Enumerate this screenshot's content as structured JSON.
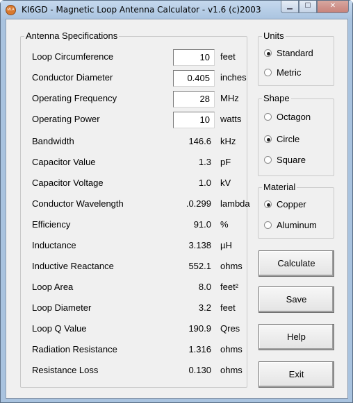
{
  "window": {
    "title": "KI6GD - Magnetic Loop Antenna Calculator - v1.6  (c)2003",
    "icon_text": "MLA",
    "min_glyph": "▁",
    "max_glyph": "☐",
    "close_glyph": "✕"
  },
  "specs": {
    "group_label": "Antenna Specifications",
    "inputs": [
      {
        "label": "Loop Circumference",
        "value": "10",
        "unit": "feet"
      },
      {
        "label": "Conductor Diameter",
        "value": "0.405",
        "unit": "inches"
      },
      {
        "label": "Operating Frequency",
        "value": "28",
        "unit": "MHz"
      },
      {
        "label": "Operating Power",
        "value": "10",
        "unit": "watts"
      }
    ],
    "outputs": [
      {
        "label": "Bandwidth",
        "value": "146.6",
        "unit": "kHz"
      },
      {
        "label": "Capacitor Value",
        "value": "1.3",
        "unit": "pF"
      },
      {
        "label": "Capacitor Voltage",
        "value": "1.0",
        "unit": "kV"
      },
      {
        "label": "Conductor Wavelength",
        "value": ".0.299",
        "unit": "lambda"
      },
      {
        "label": "Efficiency",
        "value": "91.0",
        "unit": "%"
      },
      {
        "label": "Inductance",
        "value": "3.138",
        "unit": "µH"
      },
      {
        "label": "Inductive Reactance",
        "value": "552.1",
        "unit": "ohms"
      },
      {
        "label": "Loop Area",
        "value": "8.0",
        "unit": "feet²"
      },
      {
        "label": "Loop Diameter",
        "value": "3.2",
        "unit": "feet"
      },
      {
        "label": "Loop Q Value",
        "value": "190.9",
        "unit": "Qres"
      },
      {
        "label": "Radiation Resistance",
        "value": "1.316",
        "unit": "ohms"
      },
      {
        "label": "Resistance Loss",
        "value": "0.130",
        "unit": "ohms"
      }
    ]
  },
  "units": {
    "group_label": "Units",
    "options": [
      {
        "label": "Standard",
        "selected": true
      },
      {
        "label": "Metric",
        "selected": false
      }
    ]
  },
  "shape": {
    "group_label": "Shape",
    "options": [
      {
        "label": "Octagon",
        "selected": false
      },
      {
        "label": "Circle",
        "selected": true
      },
      {
        "label": "Square",
        "selected": false
      }
    ]
  },
  "material": {
    "group_label": "Material",
    "options": [
      {
        "label": "Copper",
        "selected": true
      },
      {
        "label": "Aluminum",
        "selected": false
      }
    ]
  },
  "buttons": {
    "calculate": "Calculate",
    "save": "Save",
    "help": "Help",
    "exit": "Exit"
  }
}
